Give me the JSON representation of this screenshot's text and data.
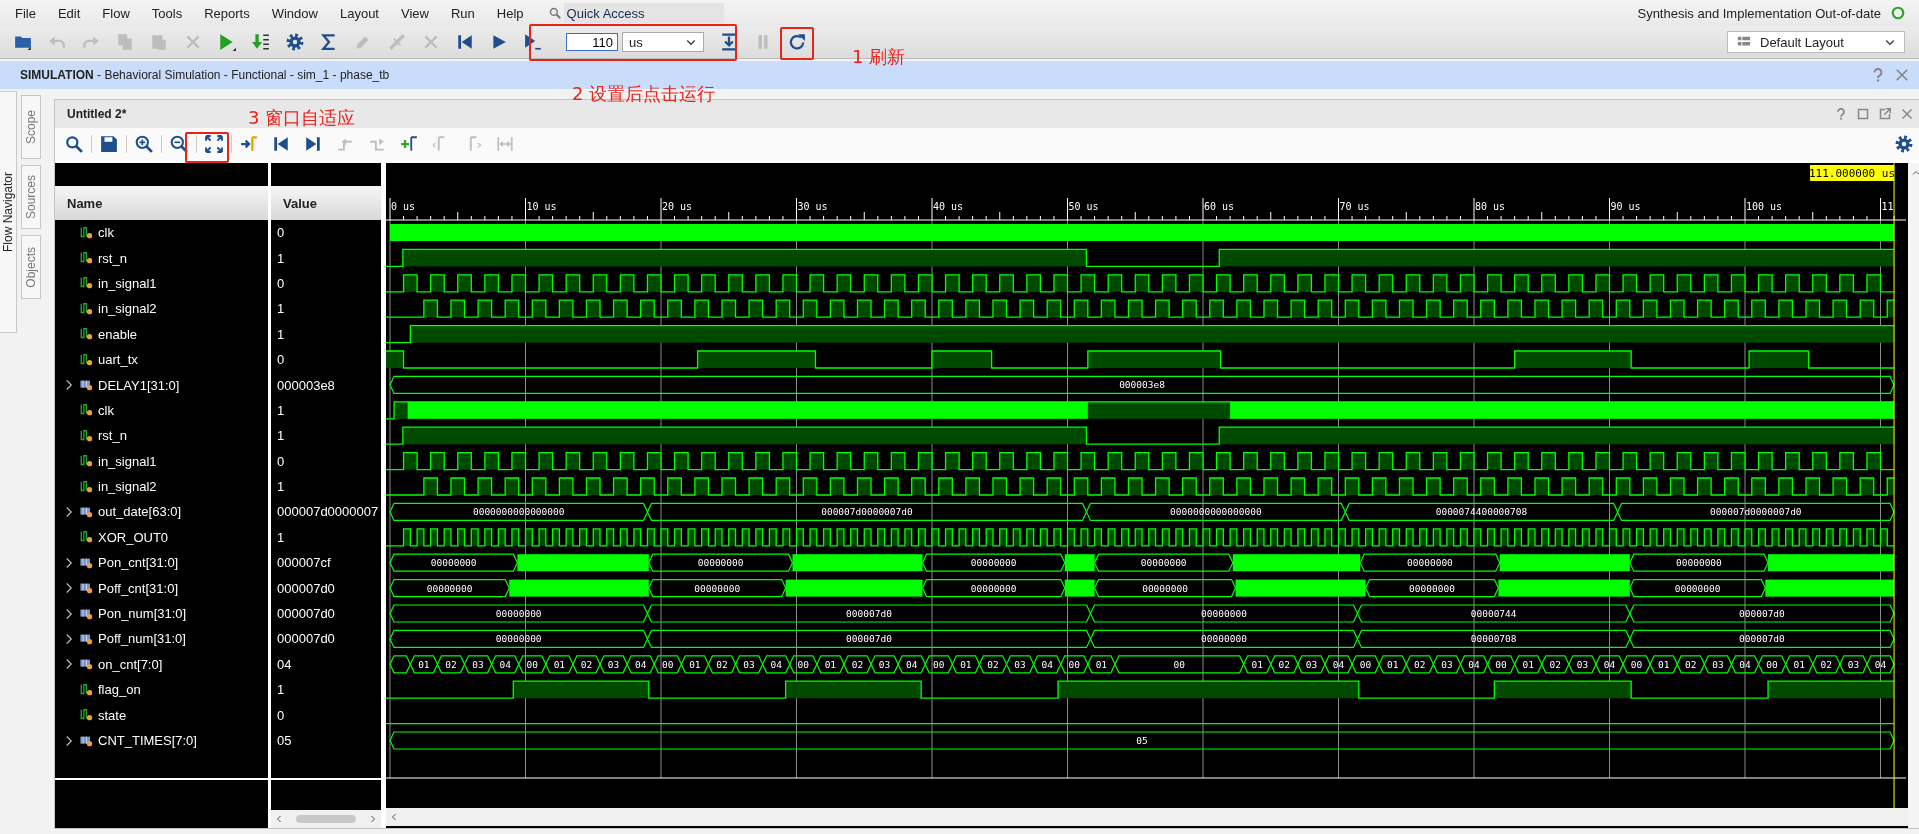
{
  "menu": [
    "File",
    "Edit",
    "Flow",
    "Tools",
    "Reports",
    "Window",
    "Layout",
    "View",
    "Run",
    "Help"
  ],
  "quick_access": {
    "placeholder": "Quick Access"
  },
  "status": {
    "text": "Synthesis and Implementation Out-of-date"
  },
  "main_toolbar": {
    "tools": [
      {
        "disabled": false
      },
      {
        "disabled": true
      },
      {
        "disabled": true
      },
      {
        "disabled": true
      },
      {
        "disabled": true
      },
      {
        "disabled": true
      },
      {
        "disabled": false
      },
      {
        "disabled": false
      },
      {
        "disabled": false
      },
      {
        "disabled": false
      },
      {
        "disabled": true
      },
      {
        "disabled": true
      },
      {
        "disabled": true
      },
      {
        "disabled": false
      },
      {
        "disabled": false
      },
      {
        "disabled": false
      },
      {
        "disabled": false
      },
      {
        "disabled": true
      },
      {
        "disabled": false
      }
    ],
    "run_time": {
      "value": "110",
      "unit": "us"
    },
    "layout": "Default Layout"
  },
  "simulation_header": "**SIMULATION** - Behavioral Simulation - Functional - sim_1 - phase_tb",
  "side_panel": {
    "flow_navigator": "Flow Navigator",
    "tabs": [
      "Scope",
      "Sources",
      "Objects"
    ]
  },
  "wave_window": {
    "title": "Untitled 2*",
    "tools": [
      {
        "disabled": false
      },
      {
        "disabled": false
      },
      {
        "disabled": false
      },
      {
        "disabled": false
      },
      {
        "disabled": false
      },
      {
        "disabled": false
      },
      {
        "disabled": false
      },
      {
        "disabled": false
      },
      {
        "disabled": true
      },
      {
        "disabled": true
      },
      {
        "disabled": false
      },
      {
        "disabled": true
      },
      {
        "disabled": true
      },
      {
        "disabled": true
      },
      {
        "disabled": false
      }
    ],
    "columns": [
      "Name",
      "Value"
    ],
    "timeline": [
      "0 us",
      "10 us",
      "20 us",
      "30 us",
      "40 us",
      "50 us",
      "60 us",
      "70 us",
      "80 us",
      "90 us",
      "100 us",
      "11"
    ],
    "cursor": "111.000000 us",
    "signals": [
      {
        "name": "clk",
        "value": "0",
        "kind": "bit"
      },
      {
        "name": "rst_n",
        "value": "1",
        "kind": "bit"
      },
      {
        "name": "in_signal1",
        "value": "0",
        "kind": "bit"
      },
      {
        "name": "in_signal2",
        "value": "1",
        "kind": "bit"
      },
      {
        "name": "enable",
        "value": "1",
        "kind": "bit"
      },
      {
        "name": "uart_tx",
        "value": "0",
        "kind": "bit"
      },
      {
        "name": "DELAY1[31:0]",
        "value": "000003e8",
        "kind": "bus",
        "expanded": false,
        "segments": [
          "000003e8"
        ]
      },
      {
        "name": "clk",
        "value": "1",
        "kind": "bit"
      },
      {
        "name": "rst_n",
        "value": "1",
        "kind": "bit"
      },
      {
        "name": "in_signal1",
        "value": "0",
        "kind": "bit"
      },
      {
        "name": "in_signal2",
        "value": "1",
        "kind": "bit"
      },
      {
        "name": "out_date[63:0]",
        "value": "000007d0000007",
        "kind": "bus",
        "expanded": false,
        "segments": [
          "0000000000000000",
          "000007d0000007d0",
          "0000000000000000",
          "0000074400000708",
          "000007d0000007d0"
        ]
      },
      {
        "name": "XOR_OUT0",
        "value": "1",
        "kind": "bit"
      },
      {
        "name": "Pon_cnt[31:0]",
        "value": "000007cf",
        "kind": "bus",
        "expanded": false,
        "segments": [
          "00000000",
          "00000000",
          "00000000",
          "00000000",
          "00000000",
          "00000000"
        ]
      },
      {
        "name": "Poff_cnt[31:0]",
        "value": "000007d0",
        "kind": "bus",
        "expanded": false,
        "segments": [
          "00000000",
          "00000000",
          "00000000",
          "00000000",
          "00000000",
          "00000000"
        ]
      },
      {
        "name": "Pon_num[31:0]",
        "value": "000007d0",
        "kind": "bus",
        "expanded": false,
        "segments": [
          "00000000",
          "000007d0",
          "00000000",
          "00000744",
          "000007d0"
        ]
      },
      {
        "name": "Poff_num[31:0]",
        "value": "000007d0",
        "kind": "bus",
        "expanded": false,
        "segments": [
          "00000000",
          "000007d0",
          "00000000",
          "00000708",
          "000007d0"
        ]
      },
      {
        "name": "on_cnt[7:0]",
        "value": "04",
        "kind": "bus",
        "expanded": false,
        "segments": [
          "01",
          "02",
          "03",
          "04",
          "00",
          "01",
          "02",
          "03",
          "04",
          "00",
          "01",
          "02",
          "03",
          "04",
          "00",
          "01",
          "02",
          "03",
          "04",
          "00",
          "01",
          "02",
          "03",
          "04",
          "00",
          "01",
          "00",
          "01",
          "02",
          "03",
          "04",
          "00",
          "01",
          "02",
          "03",
          "04",
          "00",
          "01",
          "02",
          "03",
          "04",
          "00",
          "01",
          "02",
          "03",
          "04",
          "00",
          "01",
          "02",
          "03",
          "04"
        ]
      },
      {
        "name": "flag_on",
        "value": "1",
        "kind": "bit"
      },
      {
        "name": "state",
        "value": "0",
        "kind": "bit"
      },
      {
        "name": "CNT_TIMES[7:0]",
        "value": "05",
        "kind": "bus",
        "expanded": false,
        "segments": [
          "05"
        ]
      }
    ]
  },
  "annotations": [
    "1 刷新",
    "2 设置后点击运行",
    "3 窗口自适应"
  ]
}
